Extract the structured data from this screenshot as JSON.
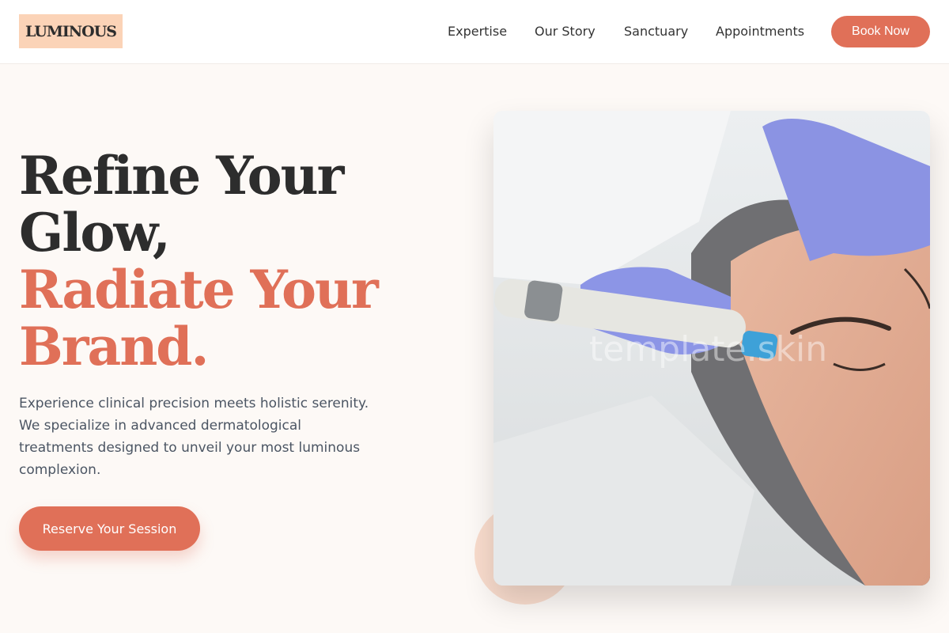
{
  "header": {
    "logo": "LUMINOUS",
    "nav": [
      "Expertise",
      "Our Story",
      "Sanctuary",
      "Appointments"
    ],
    "book_label": "Book Now"
  },
  "hero": {
    "headline_lines": [
      "Refine Your",
      "Glow,",
      "Radiate Your",
      "Brand."
    ],
    "lead": "Experience clinical precision meets holistic serenity. We specialize in advanced dermatological treatments designed to unveil your most luminous complexion.",
    "cta_label": "Reserve Your Session",
    "image_watermark": "template.skin"
  },
  "colors": {
    "accent": "#e07058",
    "logo_bg": "#fbd3b7",
    "page_bg": "#fdf9f6",
    "text_dark": "#2d2d2d"
  }
}
